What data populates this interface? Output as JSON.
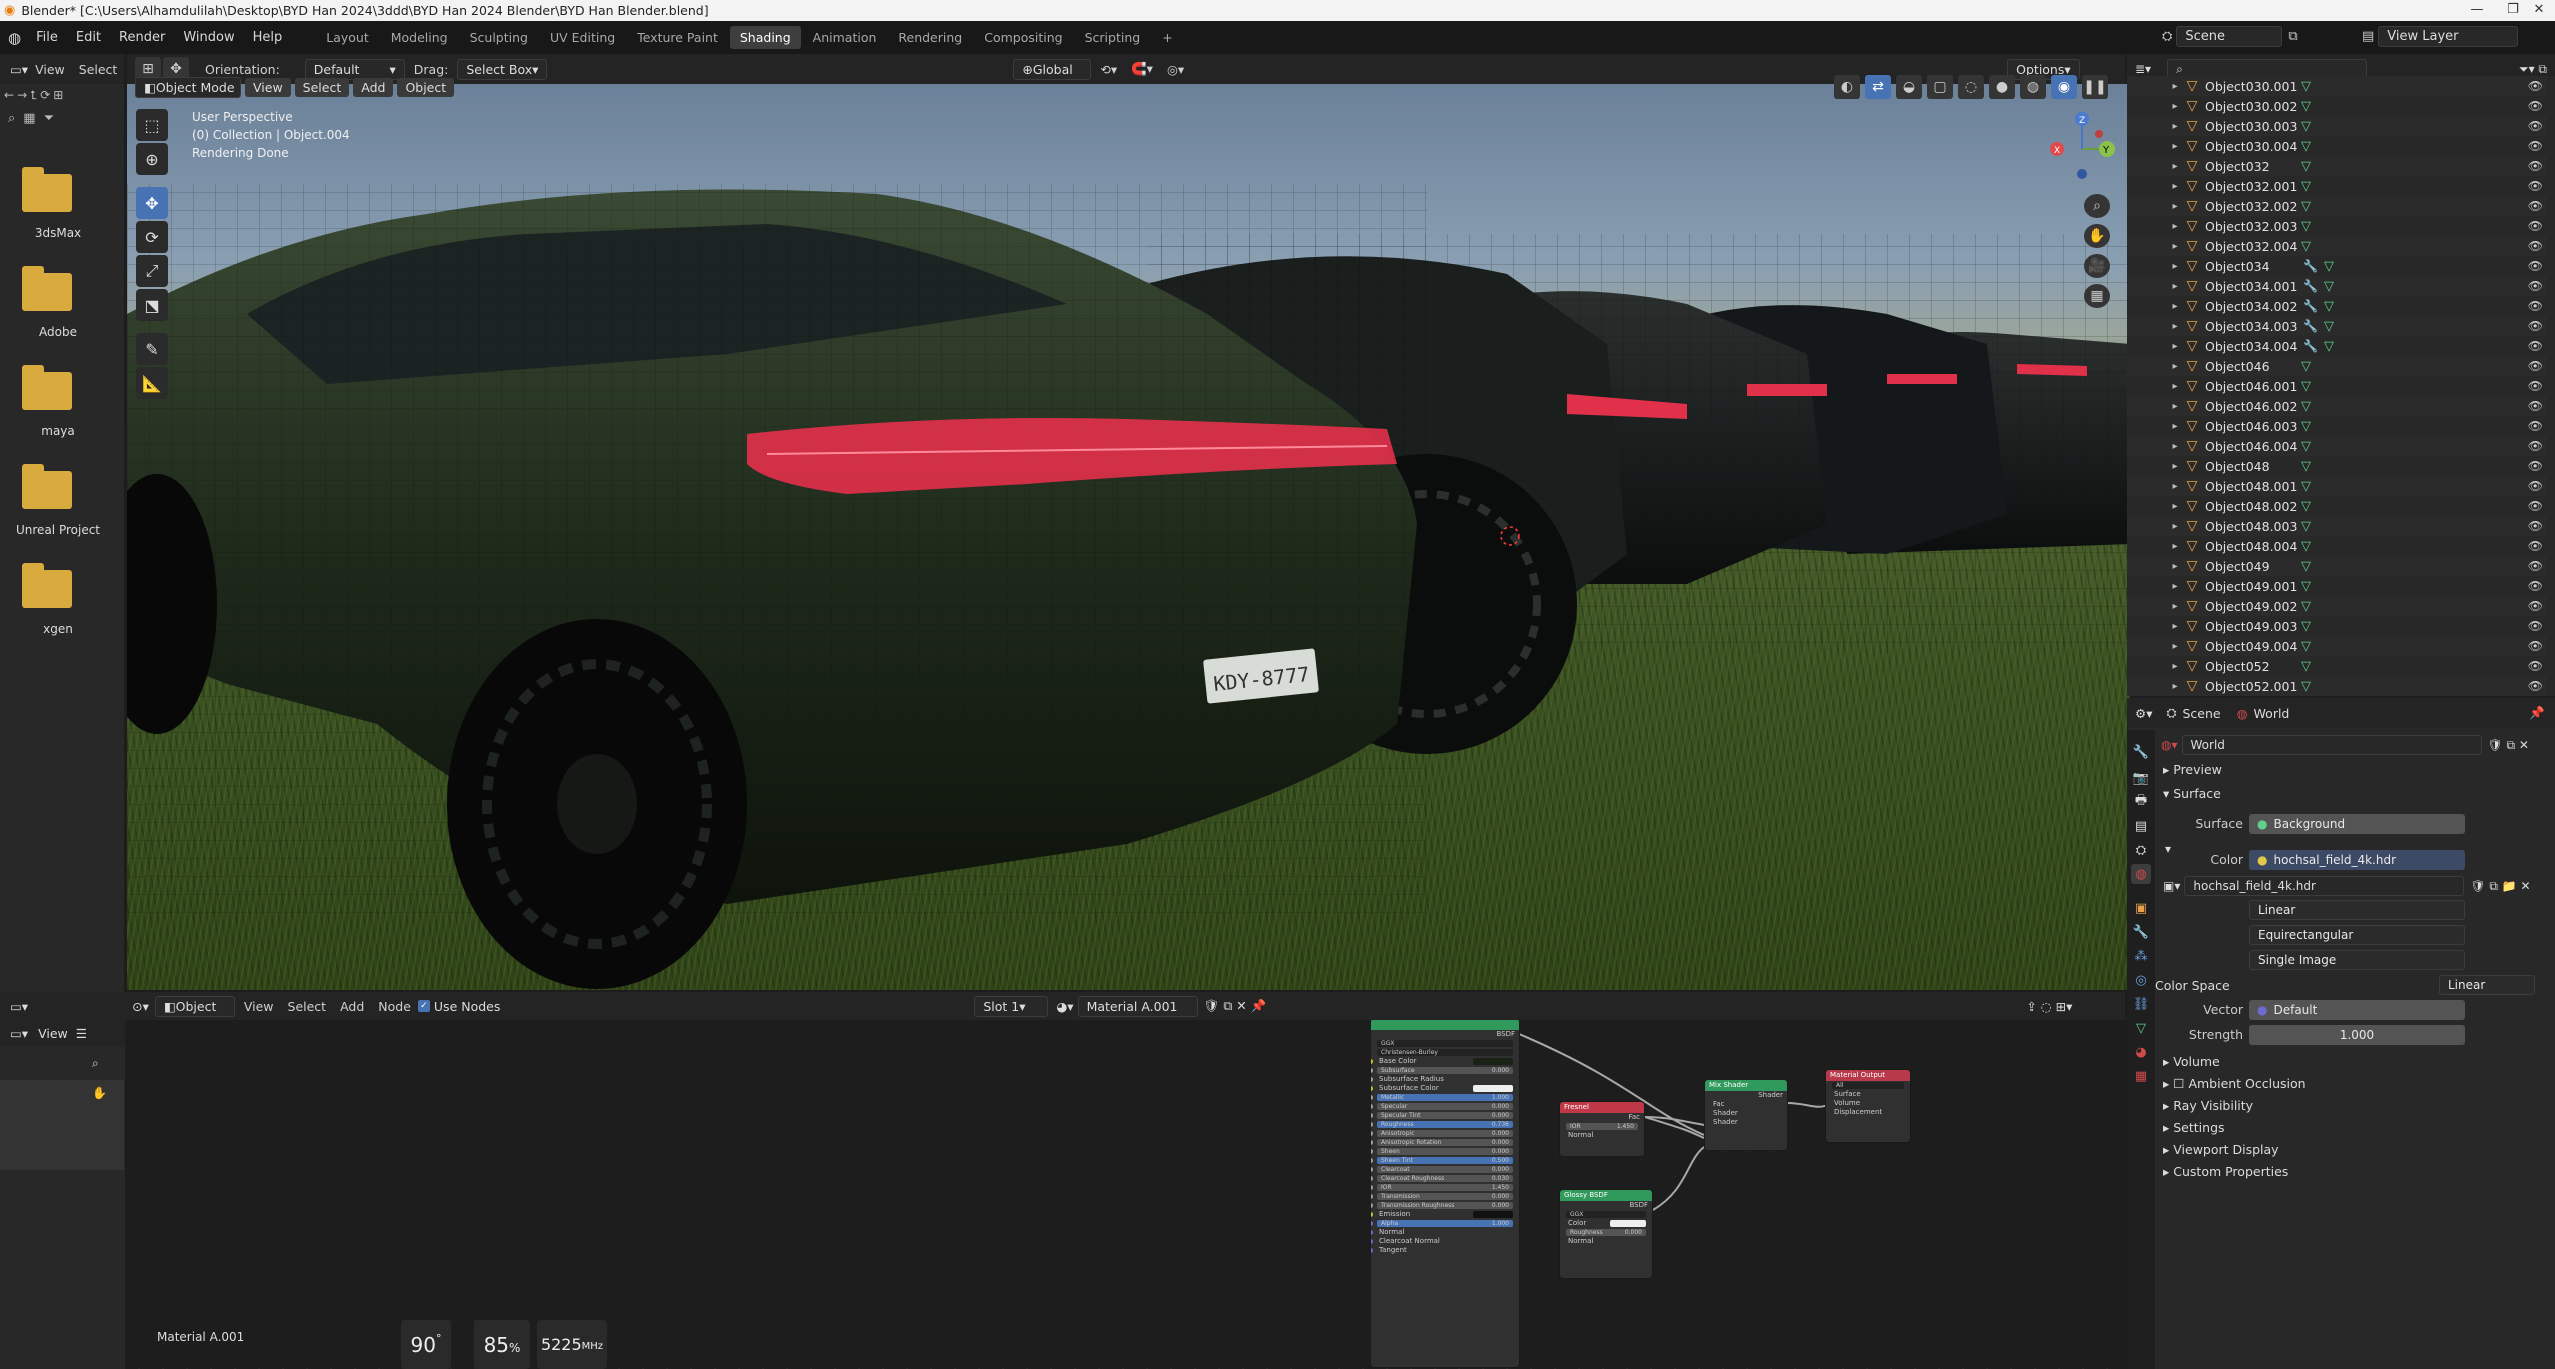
{
  "window": {
    "title": "Blender* [C:\\Users\\Alhamdulilah\\Desktop\\BYD Han 2024\\3ddd\\BYD Han 2024 Blender\\BYD Han Blender.blend]"
  },
  "menu": {
    "items": [
      "File",
      "Edit",
      "Render",
      "Window",
      "Help"
    ]
  },
  "workspaces": [
    "Layout",
    "Modeling",
    "Sculpting",
    "UV Editing",
    "Texture Paint",
    "Shading",
    "Animation",
    "Rendering",
    "Compositing",
    "Scripting"
  ],
  "active_workspace": "Shading",
  "top_right": {
    "scene": "Scene",
    "view_layer": "View Layer"
  },
  "filebrowser": {
    "view": "View",
    "select": "Select",
    "folders": [
      "3dsMax",
      "Adobe",
      "maya",
      "Unreal Project",
      "xgen"
    ]
  },
  "viewport": {
    "mode": "Object Mode",
    "view": "View",
    "select": "Select",
    "add": "Add",
    "object": "Object",
    "orientation_label": "Orientation:",
    "orientation": "Default",
    "drag_label": "Drag:",
    "drag": "Select Box",
    "transform": "Global",
    "options": "Options",
    "info_perspective": "User Perspective",
    "info_collection": "(0) Collection | Object.004",
    "info_status": "Rendering Done",
    "plate": "KDY-8777"
  },
  "outliner": {
    "items": [
      {
        "name": "Object030.001",
        "wrench": false
      },
      {
        "name": "Object030.002",
        "wrench": false
      },
      {
        "name": "Object030.003",
        "wrench": false
      },
      {
        "name": "Object030.004",
        "wrench": false
      },
      {
        "name": "Object032",
        "wrench": false
      },
      {
        "name": "Object032.001",
        "wrench": false
      },
      {
        "name": "Object032.002",
        "wrench": false
      },
      {
        "name": "Object032.003",
        "wrench": false
      },
      {
        "name": "Object032.004",
        "wrench": false
      },
      {
        "name": "Object034",
        "wrench": true
      },
      {
        "name": "Object034.001",
        "wrench": true
      },
      {
        "name": "Object034.002",
        "wrench": true
      },
      {
        "name": "Object034.003",
        "wrench": true
      },
      {
        "name": "Object034.004",
        "wrench": true
      },
      {
        "name": "Object046",
        "wrench": false
      },
      {
        "name": "Object046.001",
        "wrench": false
      },
      {
        "name": "Object046.002",
        "wrench": false
      },
      {
        "name": "Object046.003",
        "wrench": false
      },
      {
        "name": "Object046.004",
        "wrench": false
      },
      {
        "name": "Object048",
        "wrench": false
      },
      {
        "name": "Object048.001",
        "wrench": false
      },
      {
        "name": "Object048.002",
        "wrench": false
      },
      {
        "name": "Object048.003",
        "wrench": false
      },
      {
        "name": "Object048.004",
        "wrench": false
      },
      {
        "name": "Object049",
        "wrench": false
      },
      {
        "name": "Object049.001",
        "wrench": false
      },
      {
        "name": "Object049.002",
        "wrench": false
      },
      {
        "name": "Object049.003",
        "wrench": false
      },
      {
        "name": "Object049.004",
        "wrench": false
      },
      {
        "name": "Object052",
        "wrench": false
      },
      {
        "name": "Object052.001",
        "wrench": false
      }
    ]
  },
  "properties": {
    "breadcrumb_scene": "Scene",
    "breadcrumb_world": "World",
    "world_name": "World",
    "preview": "Preview",
    "surface_panel": "Surface",
    "surface_label": "Surface",
    "surface_value": "Background",
    "color_label": "Color",
    "color_value": "hochsal_field_4k.hdr",
    "image_name": "hochsal_field_4k.hdr",
    "interpolation": "Linear",
    "projection": "Equirectangular",
    "source": "Single Image",
    "color_space_label": "Color Space",
    "color_space": "Linear",
    "vector_label": "Vector",
    "vector_value": "Default",
    "strength_label": "Strength",
    "strength_value": "1.000",
    "panels": [
      "Volume",
      "Ambient Occlusion",
      "Ray Visibility",
      "Settings",
      "Viewport Display",
      "Custom Properties"
    ]
  },
  "node_editor": {
    "object": "Object",
    "view": "View",
    "select": "Select",
    "add": "Add",
    "node": "Node",
    "use_nodes": "Use Nodes",
    "slot": "Slot 1",
    "material": "Material A.001",
    "material_label": "Material A.001",
    "left_view": "View",
    "nodes": {
      "principled_rows": [
        "GGX",
        "Christensen-Burley",
        "Base Color",
        "Subsurface",
        "Subsurface Radius",
        "Subsurface Color",
        "Metallic",
        "Specular",
        "Specular Tint",
        "Roughness",
        "Anisotropic",
        "Anisotropic Rotation",
        "Sheen",
        "Sheen Tint",
        "Clearcoat",
        "Clearcoat Roughness",
        "IOR",
        "Transmission",
        "Transmission Roughness",
        "Emission",
        "Alpha",
        "Normal",
        "Clearcoat Normal",
        "Tangent"
      ],
      "principled_values": [
        "",
        "",
        "",
        "0.000",
        "",
        "",
        "1.000",
        "0.000",
        "0.000",
        "0.736",
        "0.000",
        "0.000",
        "0.000",
        "0.500",
        "0.000",
        "0.030",
        "1.450",
        "0.000",
        "0.000",
        "",
        "1.000",
        "",
        "",
        ""
      ],
      "fresnel_title": "Fresnel",
      "fresnel_ior": "1.450",
      "fresnel_fac": "Fac",
      "fresnel_normal": "Normal",
      "mix_title": "Mix Shader",
      "mix_rows": [
        "Shader",
        "Fac",
        "Shader",
        "Shader"
      ],
      "output_title": "Material Output",
      "output_rows": [
        "All",
        "Surface",
        "Volume",
        "Displacement"
      ],
      "glossy_title": "Glossy BSDF",
      "glossy_rows": [
        "BSDF",
        "GGX",
        "Color",
        "Roughness",
        "Normal"
      ],
      "glossy_rough": "0.000"
    }
  },
  "stats": {
    "temp_value": "90",
    "temp_unit": "°",
    "usage_value": "85",
    "usage_unit": "%",
    "clock_value": "5225",
    "clock_unit": "MHz"
  },
  "colors": {
    "accent": "#4772b3",
    "object_icon": "#e9a04c",
    "mesh_icon": "#5fcf8a",
    "taillight": "#e0304a"
  }
}
